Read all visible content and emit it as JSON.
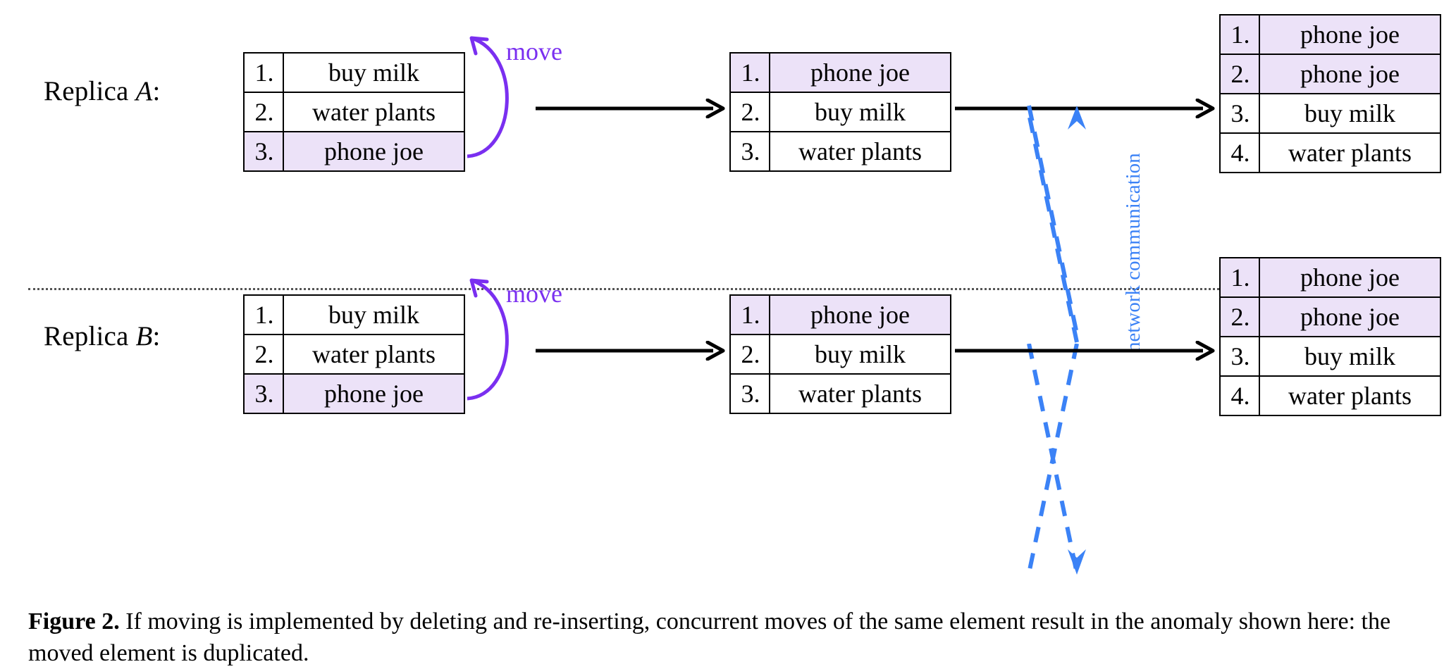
{
  "figure": {
    "caption_label": "Figure 2.",
    "caption_text": " If moving is implemented by deleting and re-inserting, concurrent moves of the same element result in the anomaly shown here: the moved element is duplicated."
  },
  "colors": {
    "highlight": "#ece2f8",
    "move_purple": "#7a2ff0",
    "network_blue": "#3b82f6",
    "line_black": "#000000",
    "separator": "#555555"
  },
  "labels": {
    "replica_a_prefix": "Replica ",
    "replica_a_name": "A",
    "replica_a_suffix": ":",
    "replica_b_prefix": "Replica ",
    "replica_b_name": "B",
    "replica_b_suffix": ":",
    "move_a": "move",
    "move_b": "move",
    "network": "network communication"
  },
  "replica_a": {
    "before": {
      "rows": [
        {
          "num": "1.",
          "item": "buy milk",
          "highlighted": false
        },
        {
          "num": "2.",
          "item": "water plants",
          "highlighted": false
        },
        {
          "num": "3.",
          "item": "phone joe",
          "highlighted": true
        }
      ]
    },
    "after_move": {
      "rows": [
        {
          "num": "1.",
          "item": "phone joe",
          "highlighted": true
        },
        {
          "num": "2.",
          "item": "buy milk",
          "highlighted": false
        },
        {
          "num": "3.",
          "item": "water plants",
          "highlighted": false
        }
      ]
    },
    "after_merge": {
      "rows": [
        {
          "num": "1.",
          "item": "phone joe",
          "highlighted": true
        },
        {
          "num": "2.",
          "item": "phone joe",
          "highlighted": true
        },
        {
          "num": "3.",
          "item": "buy milk",
          "highlighted": false
        },
        {
          "num": "4.",
          "item": "water plants",
          "highlighted": false
        }
      ]
    }
  },
  "replica_b": {
    "before": {
      "rows": [
        {
          "num": "1.",
          "item": "buy milk",
          "highlighted": false
        },
        {
          "num": "2.",
          "item": "water plants",
          "highlighted": false
        },
        {
          "num": "3.",
          "item": "phone joe",
          "highlighted": true
        }
      ]
    },
    "after_move": {
      "rows": [
        {
          "num": "1.",
          "item": "phone joe",
          "highlighted": true
        },
        {
          "num": "2.",
          "item": "buy milk",
          "highlighted": false
        },
        {
          "num": "3.",
          "item": "water plants",
          "highlighted": false
        }
      ]
    },
    "after_merge": {
      "rows": [
        {
          "num": "1.",
          "item": "phone joe",
          "highlighted": true
        },
        {
          "num": "2.",
          "item": "phone joe",
          "highlighted": true
        },
        {
          "num": "3.",
          "item": "buy milk",
          "highlighted": false
        },
        {
          "num": "4.",
          "item": "water plants",
          "highlighted": false
        }
      ]
    }
  }
}
